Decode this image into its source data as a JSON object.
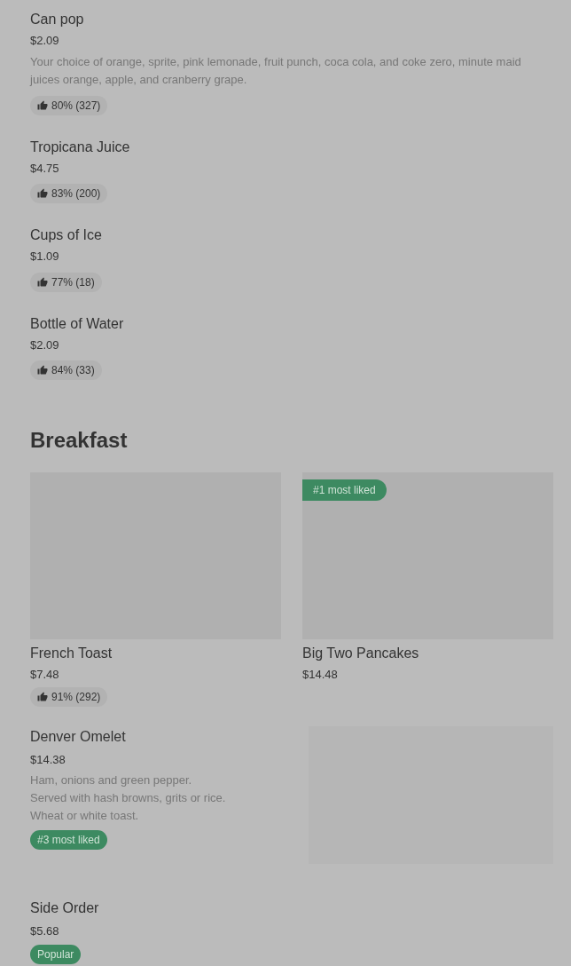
{
  "drinks": [
    {
      "name": "Can pop",
      "price": "$2.09",
      "description": "Your choice of orange, sprite, pink lemonade, fruit punch, coca cola, and coke zero, minute maid juices orange, apple, and cranberry grape.",
      "rating": "80% (327)"
    },
    {
      "name": "Tropicana Juice",
      "price": "$4.75",
      "rating": "83% (200)"
    },
    {
      "name": "Cups of Ice",
      "price": "$1.09",
      "rating": "77% (18)"
    },
    {
      "name": "Bottle of Water",
      "price": "$2.09",
      "rating": "84% (33)"
    }
  ],
  "breakfast": {
    "title": "Breakfast",
    "cards": [
      {
        "name": "French Toast",
        "price": "$7.48",
        "rating": "91% (292)"
      },
      {
        "name": "Big Two Pancakes",
        "price": "$14.48",
        "badge": "#1 most liked"
      }
    ],
    "rows": [
      {
        "name": "Denver Omelet",
        "price": "$14.38",
        "description": "Ham, onions and green pepper.\nServed with hash browns, grits or rice.\nWheat or white toast.",
        "tag": "#3 most liked",
        "image": true
      },
      {
        "name": "Side Order",
        "price": "$5.68",
        "tag": "Popular",
        "image": false
      }
    ]
  }
}
